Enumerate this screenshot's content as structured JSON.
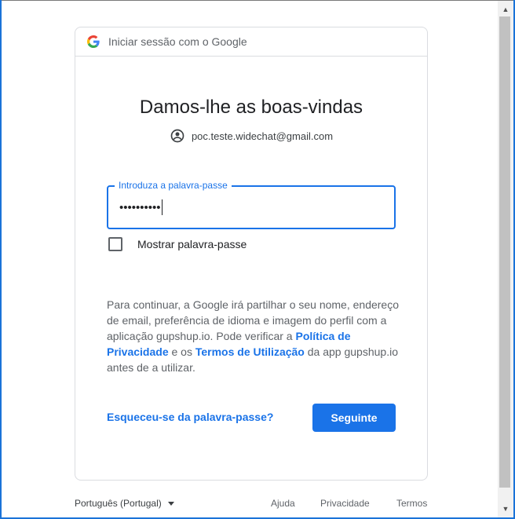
{
  "header": {
    "text": "Iniciar sessão com o Google",
    "logo_icon": "google-g-logo"
  },
  "title": "Damos-lhe as boas-vindas",
  "account": {
    "icon": "account-circle-icon",
    "email": "poc.teste.widechat@gmail.com"
  },
  "password": {
    "label": "Introduza a palavra-passe",
    "value": "••••••••••"
  },
  "show_password": {
    "label": "Mostrar palavra-passe",
    "checked": false
  },
  "info": {
    "part1": "Para continuar, a Google irá partilhar o seu nome, endereço de email, preferência de idioma e imagem do perfil com a aplicação gupshup.io. Pode verificar a ",
    "privacy_link": "Política de Privacidade",
    "part2": " e os ",
    "terms_link": "Termos de Utilização",
    "part3": " da app gupshup.io antes de a utilizar."
  },
  "actions": {
    "forgot": "Esqueceu-se da palavra-passe?",
    "next": "Seguinte"
  },
  "footer": {
    "language": "Português (Portugal)",
    "help": "Ajuda",
    "privacy": "Privacidade",
    "terms": "Termos"
  },
  "colors": {
    "accent": "#1a73e8",
    "border": "#dadce0",
    "text_secondary": "#5f6368"
  }
}
